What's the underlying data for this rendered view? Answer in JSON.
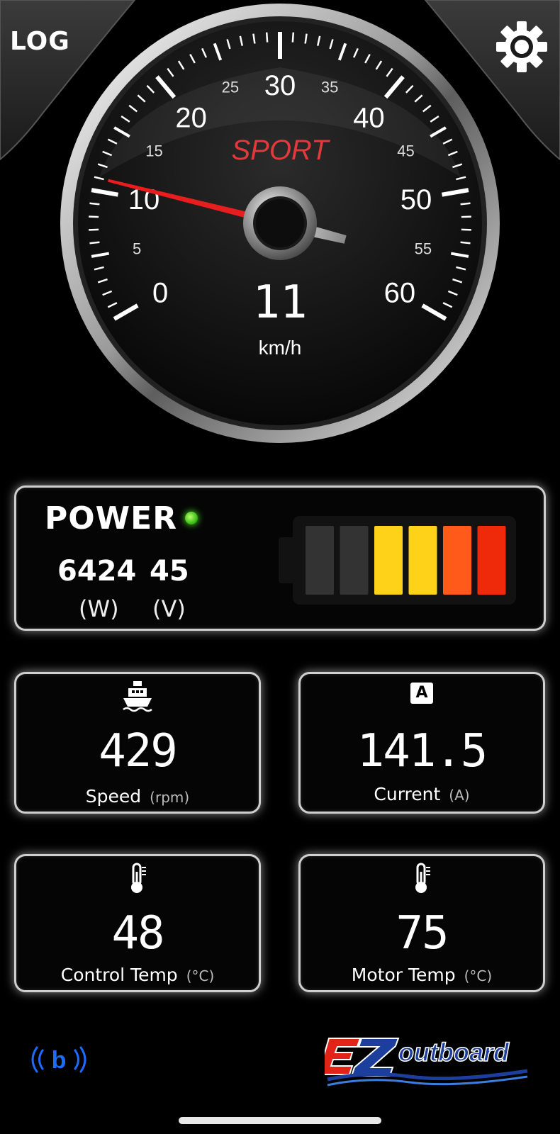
{
  "header": {
    "log_label": "LOG",
    "settings_icon": "gear-icon"
  },
  "gauge": {
    "mode_label": "SPORT",
    "speed_value": "11",
    "speed_unit": "km/h",
    "speed_max": 60,
    "speed_reading": 11,
    "major_ticks": [
      "0",
      "10",
      "20",
      "30",
      "40",
      "50",
      "60"
    ],
    "minor_ticks": [
      "5",
      "15",
      "25",
      "35",
      "45",
      "55"
    ],
    "needle_color": "#e81d1d",
    "mode_color": "#e23a3a"
  },
  "power": {
    "title": "POWER",
    "status_led": "green",
    "watts_value": "6424",
    "volts_value": "45",
    "watts_unit": "(W)",
    "volts_unit": "(V)",
    "battery_segments_total": 6,
    "battery_segments_lit": 4,
    "battery_colors": [
      "#3a3a3a",
      "#3a3a3a",
      "#ffd21a",
      "#ffd21a",
      "#ff5a1a",
      "#ee2a0a"
    ]
  },
  "tiles": {
    "speed": {
      "icon": "boat-icon",
      "value": "429",
      "label": "Speed",
      "unit": "(rpm)"
    },
    "current": {
      "icon": "ampere-icon",
      "icon_text": "A",
      "value": "141.5",
      "label": "Current",
      "unit": "(A)"
    },
    "control_temp": {
      "icon": "thermometer-icon",
      "value": "48",
      "label": "Control Temp",
      "unit": "(°C)"
    },
    "motor_temp": {
      "icon": "thermometer-icon",
      "value": "75",
      "label": "Motor Temp",
      "unit": "(°C)"
    }
  },
  "footer": {
    "bluetooth_icon_text": "b",
    "brand_logo_text": "EZoutboard",
    "brand_colors": {
      "red": "#e2231a",
      "blue": "#1c3f9e"
    }
  }
}
